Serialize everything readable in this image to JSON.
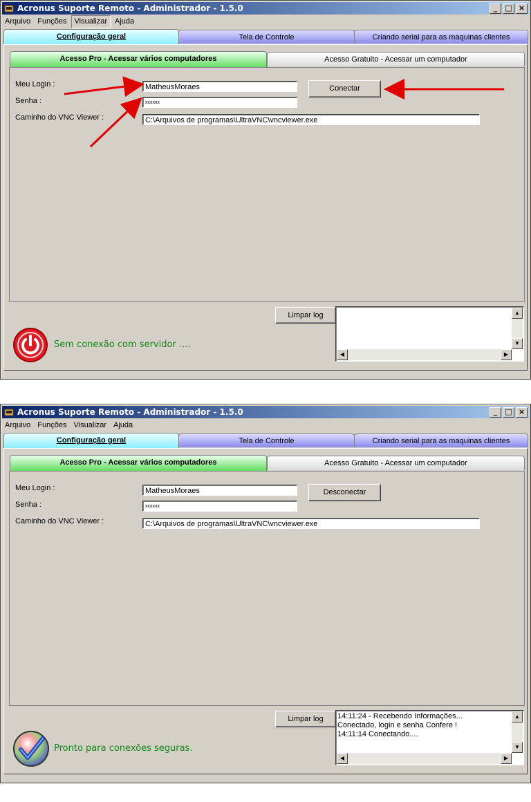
{
  "colors": {
    "title_start": "#0a246a",
    "title_end": "#a6caf0",
    "status_green": "#118811",
    "arrow_red": "#e00000",
    "power_red": "#e01a22"
  },
  "windows": [
    {
      "title": "Acronus Suporte Remoto - Administrador - 1.5.0",
      "controls": {
        "minimize": "_",
        "maximize": "□",
        "close": "×"
      },
      "menu": [
        "Arquivo",
        "Funções",
        "Visualizar",
        "Ajuda"
      ],
      "active_menu": "Visualizar",
      "tabs": [
        "Configuração geral",
        "Tela de Controle",
        "Criando serial para as maquinas clientes"
      ],
      "subtabs": [
        "Acesso Pro - Acessar vários computadores",
        "Acesso Gratuito - Acessar um computador"
      ],
      "form": {
        "login_label": "Meu Login :",
        "login_value": "MatheusMoraes",
        "password_label": "Senha :",
        "password_value": "xxxxxx",
        "vnc_label": "Caminho do VNC Viewer :",
        "vnc_value": "C:\\Arquivos de programas\\UltraVNC\\vncviewer.exe"
      },
      "connect_button": "Conectar",
      "clear_log_button": "Limpar log",
      "log_lines": [],
      "status_icon": "power-icon",
      "status_text": "Sem conexão com servidor ...."
    },
    {
      "title": "Acronus Suporte Remoto - Administrador - 1.5.0",
      "controls": {
        "minimize": "_",
        "maximize": "□",
        "close": "×"
      },
      "menu": [
        "Arquivo",
        "Funções",
        "Visualizar",
        "Ajuda"
      ],
      "active_menu": "",
      "tabs": [
        "Configuração geral",
        "Tela de Controle",
        "Criando serial para as maquinas clientes"
      ],
      "subtabs": [
        "Acesso Pro - Acessar vários computadores",
        "Acesso Gratuito - Acessar um computador"
      ],
      "form": {
        "login_label": "Meu Login :",
        "login_value": "MatheusMoraes",
        "password_label": "Senha :",
        "password_value": "xxxxxx",
        "vnc_label": "Caminho do VNC Viewer :",
        "vnc_value": "C:\\Arquivos de programas\\UltraVNC\\vncviewer.exe"
      },
      "connect_button": "Desconectar",
      "clear_log_button": "Limpar log",
      "log_lines": [
        "14:11:24 - Recebendo Informações...",
        "Conectado, login e senha Confere !",
        "14:11:14 Conectando...."
      ],
      "status_icon": "check-icon",
      "status_text": "Pronto para conexões seguras."
    }
  ]
}
